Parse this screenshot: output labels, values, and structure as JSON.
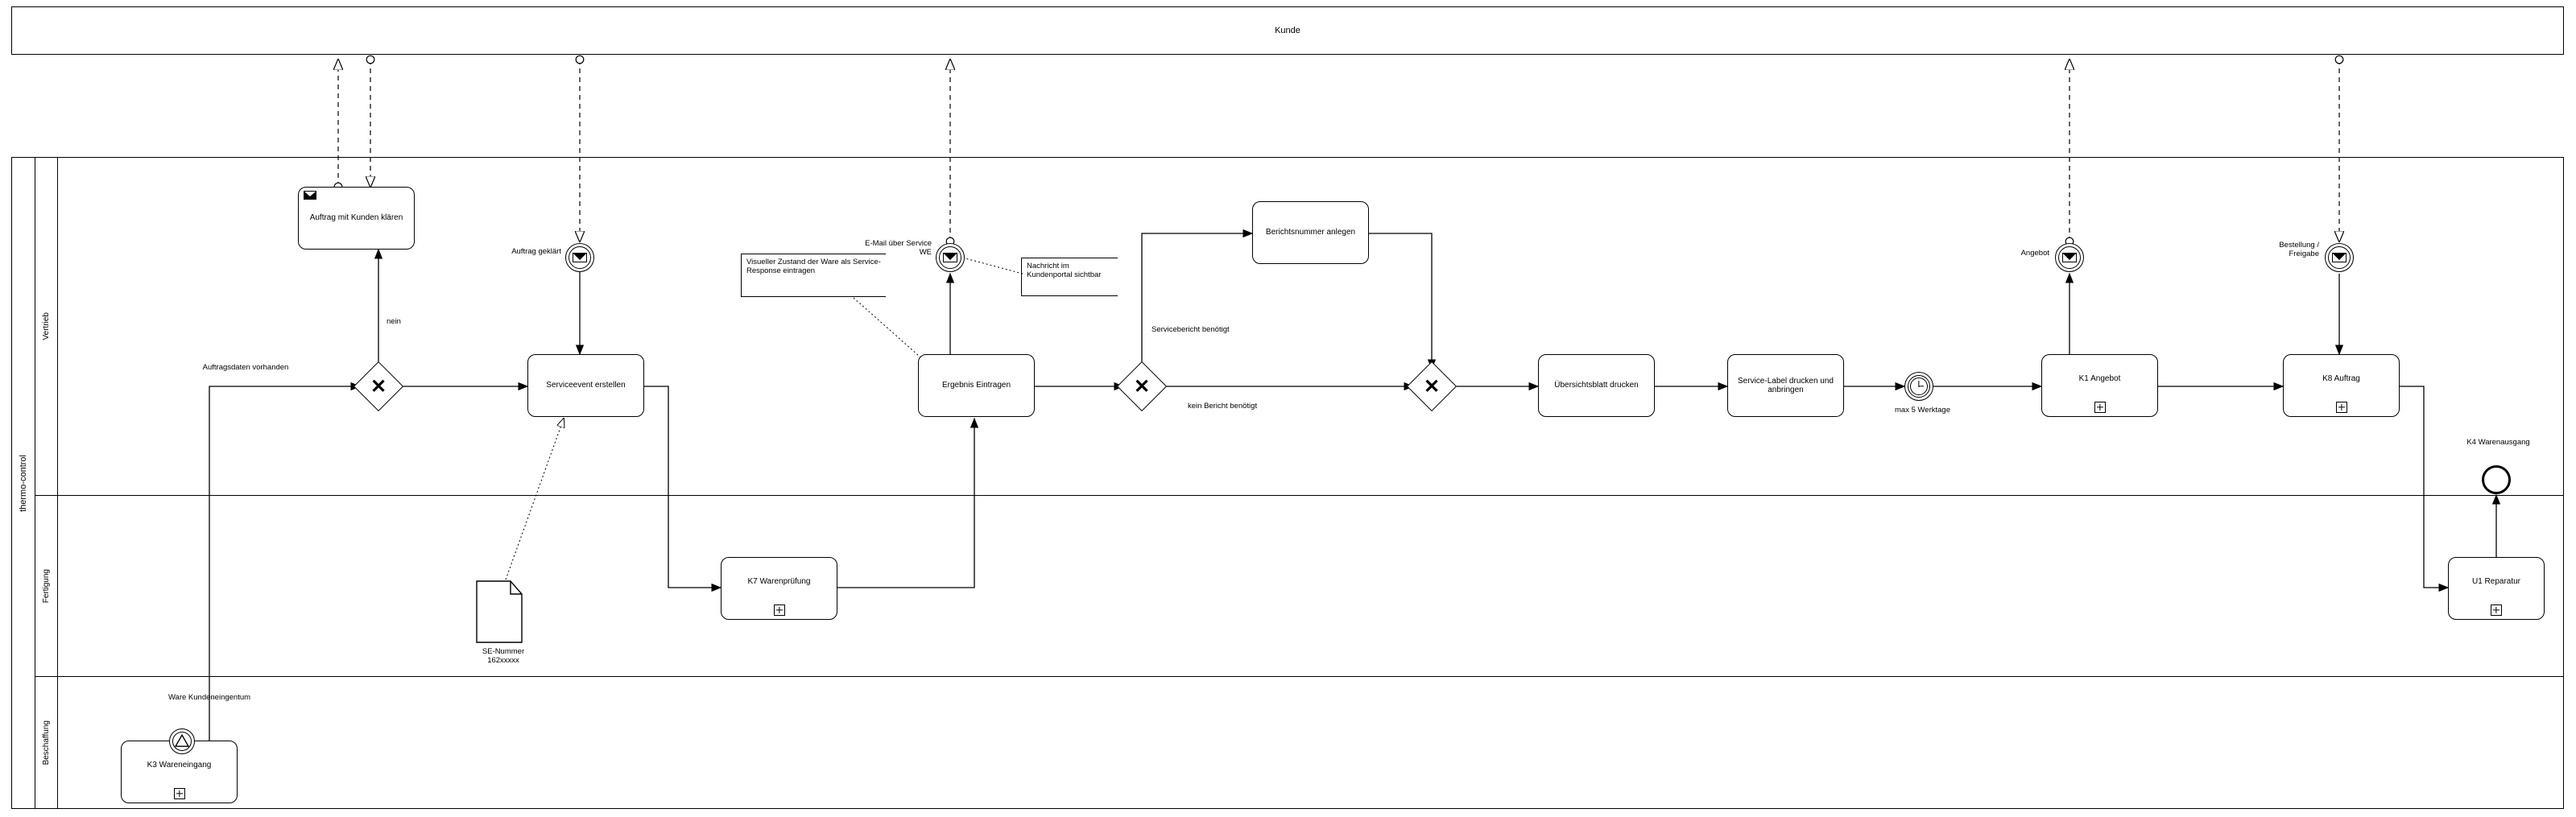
{
  "pools": {
    "customer": {
      "label": "Kunde"
    },
    "thermo": {
      "label": "thermo-control"
    }
  },
  "lanes": {
    "vertrieb": {
      "label": "Vertrieb"
    },
    "fertigung": {
      "label": "Fertigung"
    },
    "beschaffung": {
      "label": "Beschaffung"
    }
  },
  "tasks": {
    "klarify": "Auftrag mit Kunden klären",
    "serviceevent": "Serviceevent erstellen",
    "ergebnis": "Ergebnis Eintragen",
    "berichtsnr": "Berichtsnummer anlegen",
    "ubersicht": "Übersichtsblatt drucken",
    "servicelabel": "Service-Label drucken und anbringen",
    "k1": "K1 Angebot",
    "k8": "K8 Auftrag",
    "k7": "K7 Warenprüfung",
    "u1": "U1 Reparatur",
    "k3": "K3 Wareneingang"
  },
  "events": {
    "auftrag_geklart": "Auftrag geklärt",
    "email_we": "E-Mail über Service WE",
    "angebot": "Angebot",
    "bestellung": "Bestellung / Freigabe",
    "max5": "max 5 Werktage",
    "ware_kunde": "Ware Kundeneingentum",
    "k4": "K4 Warenausgang"
  },
  "gateways": {
    "g1_label": "Auftragsdaten vorhanden",
    "g1_no": "nein",
    "g2_yes": "Servicebericht benötigt",
    "g2_no": "kein Bericht benötigt"
  },
  "annotations": {
    "visuell": "Visueller Zustand der Ware als Service-Response eintragen",
    "kundenportal": "Nachricht im Kundenportal sichtbar",
    "se_nummer": "SE-Nummer 162xxxxx"
  }
}
